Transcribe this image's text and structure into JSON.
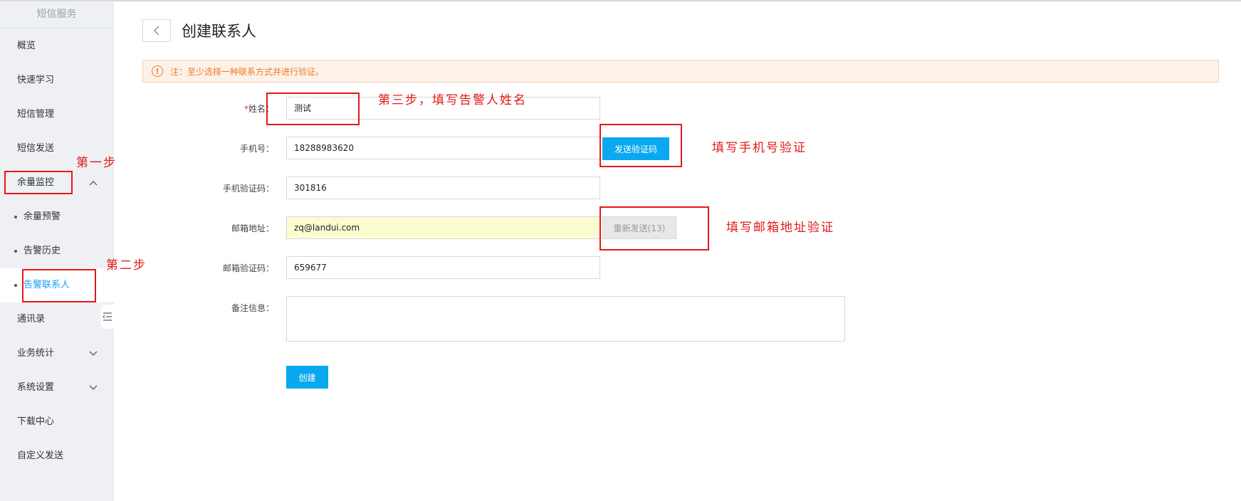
{
  "sidebar": {
    "title": "短信服务",
    "items": [
      {
        "label": "概览"
      },
      {
        "label": "快速学习"
      },
      {
        "label": "短信管理"
      },
      {
        "label": "短信发送"
      },
      {
        "label": "余量监控",
        "expanded": true
      },
      {
        "label": "通讯录"
      },
      {
        "label": "业务统计"
      },
      {
        "label": "系统设置"
      },
      {
        "label": "下载中心"
      },
      {
        "label": "自定义发送"
      }
    ],
    "subitems": [
      {
        "label": "余量预警"
      },
      {
        "label": "告警历史"
      },
      {
        "label": "告警联系人",
        "active": true
      }
    ]
  },
  "header": {
    "title": "创建联系人"
  },
  "notice": {
    "text": "注：至少选择一种联系方式并进行验证。"
  },
  "form": {
    "name": {
      "required_mark": "*",
      "label": "姓名：",
      "value": "测试"
    },
    "phone": {
      "label": "手机号：",
      "value": "18288983620",
      "button": "发送验证码"
    },
    "phone_code": {
      "label": "手机验证码：",
      "value": "301816"
    },
    "email": {
      "label": "邮箱地址：",
      "value": "zq@landui.com",
      "button": "重新发送(13)"
    },
    "email_code": {
      "label": "邮箱验证码：",
      "value": "659677"
    },
    "remark": {
      "label": "备注信息：",
      "value": ""
    },
    "submit": "创建"
  },
  "annotations": {
    "step1": "第一步",
    "step2": "第二步",
    "step3": "第三步，填写告警人姓名",
    "phone": "填写手机号验证",
    "email": "填写邮箱地址验证"
  },
  "colors": {
    "accent": "#0aa8ee",
    "active_text": "#1a9cf0",
    "annotation": "#e31818",
    "notice": "#ef7a24"
  }
}
